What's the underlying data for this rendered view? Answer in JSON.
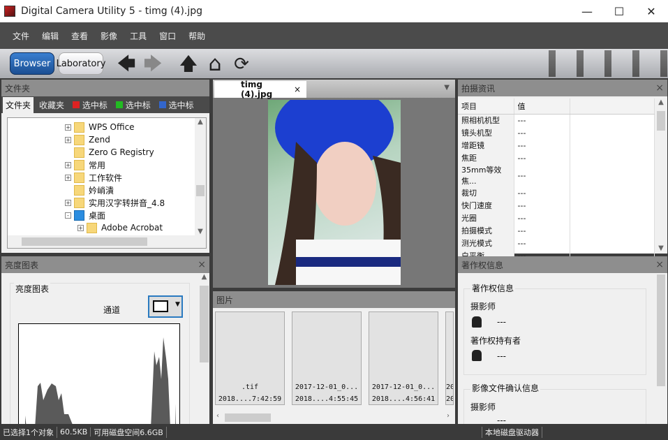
{
  "window": {
    "title": "Digital Camera Utility 5 - timg (4).jpg",
    "minimize": "—",
    "maximize": "☐",
    "close": "✕"
  },
  "menu": [
    "文件",
    "编辑",
    "查看",
    "影像",
    "工具",
    "窗口",
    "帮助"
  ],
  "toolbar": {
    "browser": "Browser",
    "laboratory": "Laboratory",
    "back": "🡄",
    "forward": "🡆",
    "up": "🡅",
    "home": "⌂",
    "refresh": "⟳"
  },
  "folder_panel": {
    "title": "文件夹",
    "tabs": [
      "文件夹",
      "收藏夹",
      "选中标",
      "选中标",
      "选中标"
    ],
    "tab_colors": [
      "#d22",
      "#2b2",
      "#36c"
    ],
    "items": [
      {
        "label": "WPS Office",
        "exp": "+"
      },
      {
        "label": "Zend",
        "exp": "+"
      },
      {
        "label": "Zero G Registry",
        "exp": ""
      },
      {
        "label": "常用",
        "exp": "+"
      },
      {
        "label": "工作软件",
        "exp": "+"
      },
      {
        "label": "妗峭潰",
        "exp": ""
      },
      {
        "label": "实用汉字转拼音_4.8",
        "exp": "+"
      },
      {
        "label": "桌面",
        "exp": "-"
      },
      {
        "label": "Adobe Acrobat",
        "exp": "+"
      }
    ]
  },
  "histogram_panel": {
    "title": "亮度图表",
    "group": "亮度图表",
    "channel": "通道"
  },
  "viewer": {
    "tab": "timg (4).jpg"
  },
  "thumbs_panel": {
    "title": "图片",
    "items": [
      {
        "name": ".tif",
        "date": "2018....7:42:59"
      },
      {
        "name": "2017-12-01_0...",
        "date": "2018....4:55:45"
      },
      {
        "name": "2017-12-01_0...",
        "date": "2018....4:56:41"
      },
      {
        "name": "20",
        "date": "20"
      }
    ]
  },
  "shooting_panel": {
    "title": "拍摄资讯",
    "col_item": "项目",
    "col_value": "值",
    "rows": [
      [
        "照相机机型",
        "---"
      ],
      [
        "镜头机型",
        "---"
      ],
      [
        "增距镜",
        "---"
      ],
      [
        "焦距",
        "---"
      ],
      [
        "35mm等效焦...",
        "---"
      ],
      [
        "裁切",
        "---"
      ],
      [
        "快门速度",
        "---"
      ],
      [
        "光圈",
        "---"
      ],
      [
        "拍摄模式",
        "---"
      ],
      [
        "测光模式",
        "---"
      ],
      [
        "白平衡",
        "---"
      ]
    ]
  },
  "copyright_panel": {
    "title": "著作权信息",
    "group": "著作权信息",
    "photographer": "摄影师",
    "photographer_value": "---",
    "holder": "著作权持有者",
    "holder_value": "---",
    "group2": "影像文件确认信息",
    "photographer2": "摄影师",
    "photographer2_value": "---"
  },
  "status": {
    "selected": "已选择1个对象",
    "size": "60.5KB",
    "disk": "可用磁盘空间6.6GB",
    "drive": "本地磁盘驱动器"
  }
}
